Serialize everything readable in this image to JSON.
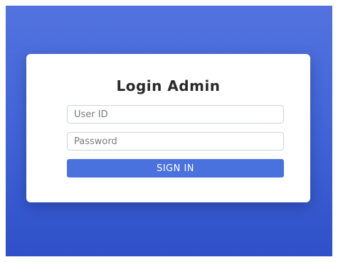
{
  "login": {
    "title": "Login Admin",
    "user_id_placeholder": "User ID",
    "user_id_value": "",
    "password_placeholder": "Password",
    "password_value": "",
    "sign_in_label": "SIGN IN"
  },
  "colors": {
    "background_gradient_top": "#5273df",
    "background_gradient_bottom": "#2f50c8",
    "card_background": "#ffffff",
    "button_background": "#4a72df",
    "button_text": "#ffffff",
    "title_text": "#2a2a2a"
  }
}
